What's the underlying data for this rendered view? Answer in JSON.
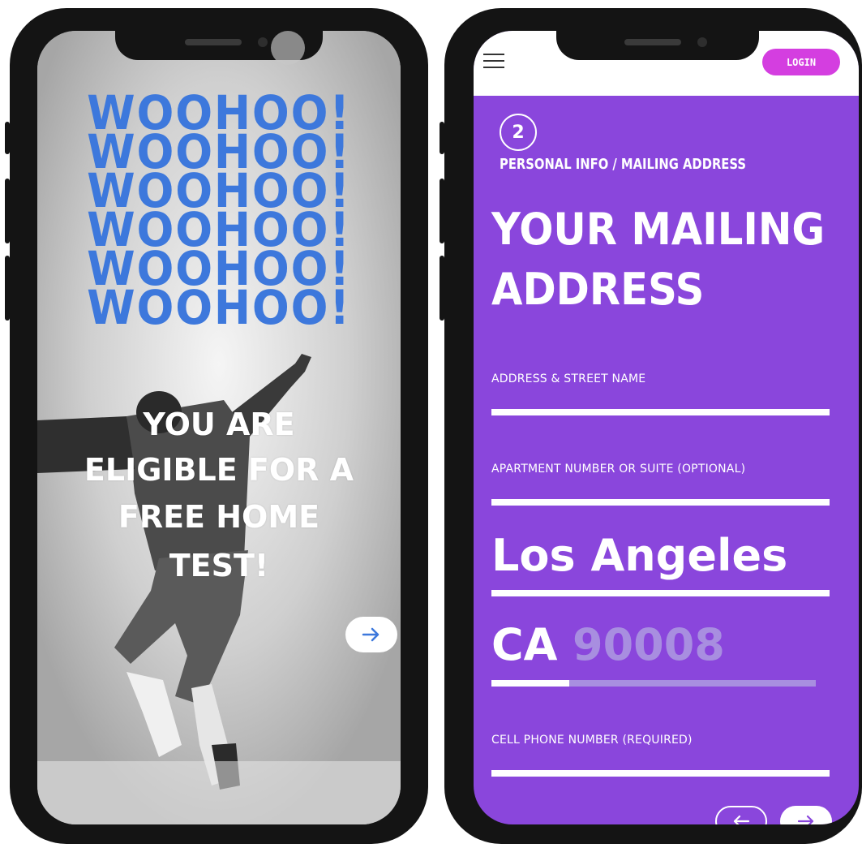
{
  "left_screen": {
    "headline_repeat": [
      "WOOHOO!",
      "WOOHOO!",
      "WOOHOO!",
      "WOOHOO!",
      "WOOHOO!",
      "WOOHOO!"
    ],
    "hero_lines": [
      "YOU ARE",
      "ELIGIBLE FOR A",
      "FREE HOME",
      "TEST!"
    ],
    "next_icon": "arrow-right-icon",
    "headline_color": "#3d78dc"
  },
  "right_screen": {
    "header": {
      "menu_icon": "hamburger-menu-icon",
      "login_label": "LOGIN"
    },
    "step_number": "2",
    "breadcrumb": "PERSONAL INFO / MAILING ADDRESS",
    "title_lines": [
      "YOUR MAILING",
      "ADDRESS"
    ],
    "fields": {
      "address_label": "ADDRESS & STREET NAME",
      "apartment_label": "APARTMENT NUMBER OR SUITE (OPTIONAL)",
      "city_value": "Los Angeles",
      "state_value": "CA",
      "zip_value": "90008",
      "phone_label": "CELL PHONE NUMBER (REQUIRED)"
    },
    "back_icon": "arrow-left-icon",
    "next_icon": "arrow-right-icon",
    "background_color": "#8a46dc",
    "login_color": "#d43ee0"
  }
}
